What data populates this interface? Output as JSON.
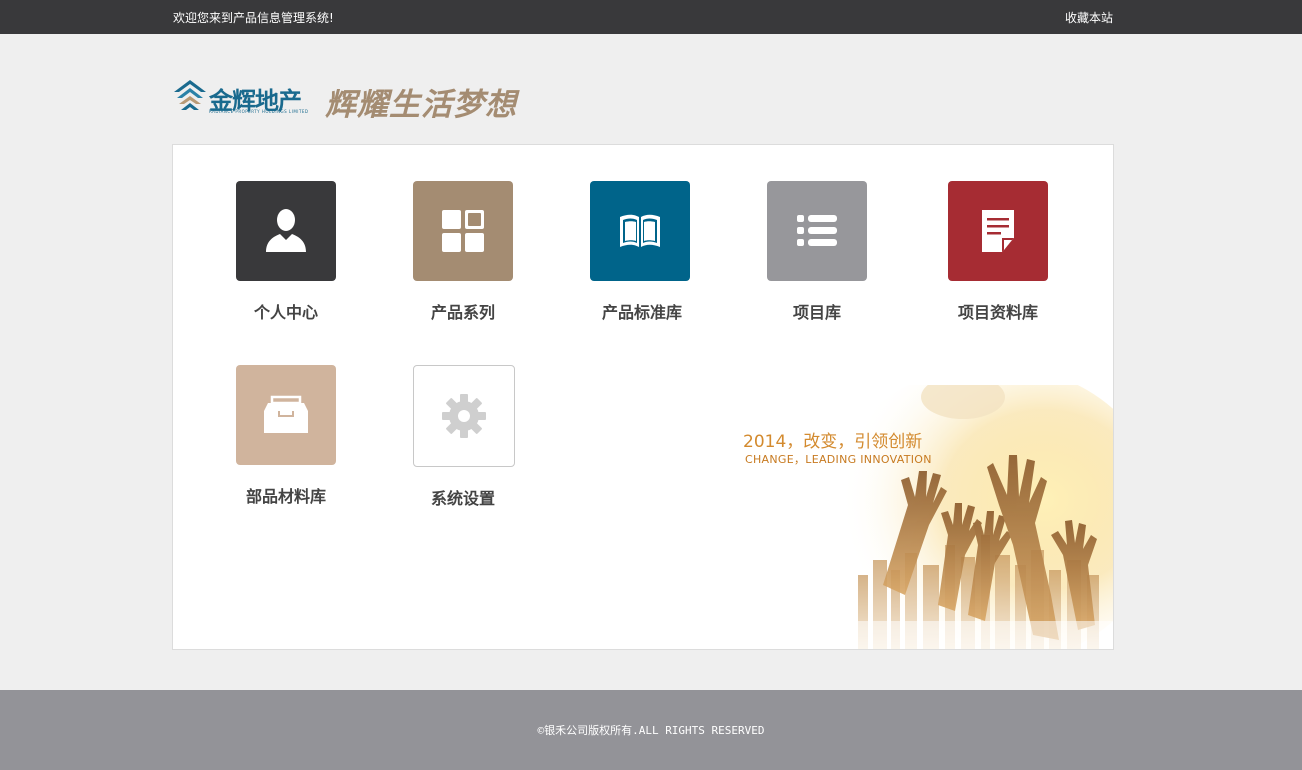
{
  "topbar": {
    "welcome": "欢迎您来到产品信息管理系统!",
    "bookmark": "收藏本站"
  },
  "logo": {
    "brand": "金辉地产",
    "brand_sub": "RADIANCE PROPERTY HOLDINGS LIMITED",
    "slogan": "辉耀生活梦想"
  },
  "tiles": [
    {
      "label": "个人中心",
      "icon": "user-icon",
      "color": "#39393b"
    },
    {
      "label": "产品系列",
      "icon": "grid-icon",
      "color": "#a48c72"
    },
    {
      "label": "产品标准库",
      "icon": "book-icon",
      "color": "#00648a"
    },
    {
      "label": "项目库",
      "icon": "list-icon",
      "color": "#97979b"
    },
    {
      "label": "项目资料库",
      "icon": "document-icon",
      "color": "#a62c33"
    },
    {
      "label": "部品材料库",
      "icon": "archive-box-icon",
      "color": "#d0b49d"
    },
    {
      "label": "系统设置",
      "icon": "gear-icon",
      "color": "#ffffff"
    }
  ],
  "promo": {
    "year_line": "2014，改变，引领创新",
    "en_line": "CHANGE，LEADING INNOVATION"
  },
  "footer": {
    "copyright": "©银禾公司版权所有.ALL RIGHTS RESERVED"
  }
}
